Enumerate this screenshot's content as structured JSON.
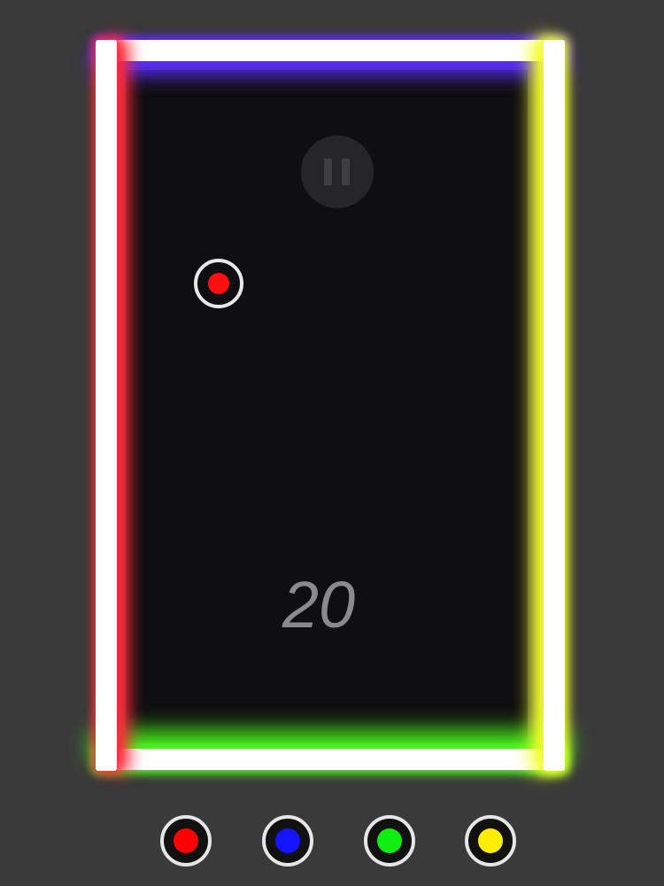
{
  "game": {
    "score": "20",
    "ball_color": "#ff1010",
    "pause_icon": "pause-icon"
  },
  "walls": {
    "top_glow": "#5a2cff",
    "bottom_glow": "#4dff1e",
    "left_glow": "#ff2a3a",
    "right_glow": "#f2ff2a"
  },
  "color_buttons": [
    {
      "name": "red",
      "color": "#ff0000"
    },
    {
      "name": "blue",
      "color": "#1414ff"
    },
    {
      "name": "green",
      "color": "#11ee11"
    },
    {
      "name": "yellow",
      "color": "#ffee00"
    }
  ]
}
